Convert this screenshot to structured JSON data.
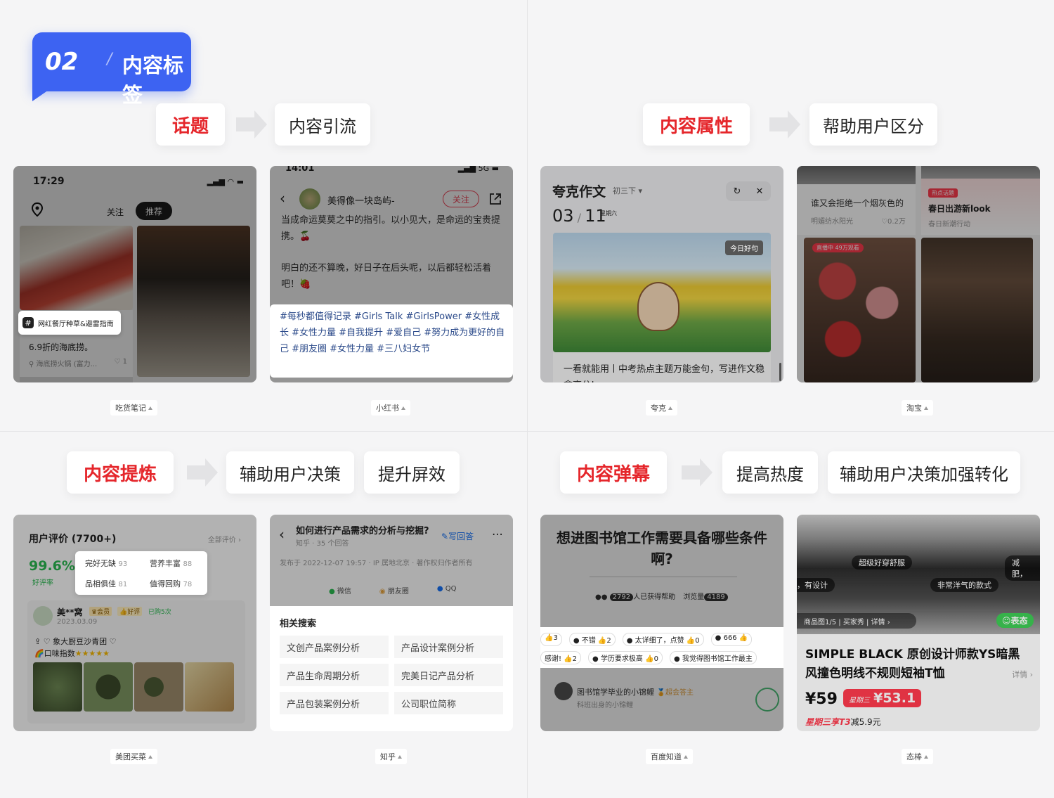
{
  "header": {
    "number": "02",
    "slash": "/",
    "title": "内容标签"
  },
  "sections": {
    "topic": {
      "main": "话题",
      "results": [
        "内容引流"
      ]
    },
    "attribute": {
      "main": "内容属性",
      "results": [
        "帮助用户区分"
      ]
    },
    "refine": {
      "main": "内容提炼",
      "results": [
        "辅助用户决策",
        "提升屏效"
      ]
    },
    "barrage": {
      "main": "内容弹幕",
      "results": [
        "提高热度",
        "辅助用户决策加强转化"
      ]
    }
  },
  "apps": [
    "吃货笔记",
    "小红书",
    "夸克",
    "淘宝",
    "美团买菜",
    "知乎",
    "百度知道",
    "态棒"
  ],
  "s1": {
    "time": "17:29",
    "tab_follow": "关注",
    "tab_recommend": "推荐",
    "topic_tag": "网红餐厅种草&避雷指南",
    "caption": "6.9折的海底捞。",
    "location": "海底捞火锅 (富力...",
    "likes": "1"
  },
  "s2": {
    "status_time": "14:01",
    "status_net": "5G",
    "author": "美得像一块岛屿-",
    "follow": "关注",
    "para1": "当成命运莫莫之中的指引。以小见大，是命运的宝贵提携。🍒",
    "para2": "明白的还不算晚，好日子在后头呢，以后都轻松活着吧！🍓",
    "hashtags": "#每秒都值得记录 #Girls Talk  #GirlsPower  #女性成长  #女性力量  #自我提升  #爱自己  #努力成为更好的自己 #朋友圈  #女性力量  #三八妇女节"
  },
  "s3": {
    "brand": "夸克作文",
    "lunar": "初三下",
    "date": "03",
    "date2": "11",
    "weekday": "星期六",
    "badge": "今日好句",
    "headline": "一看就能用丨中考热点主题万能金句，写进作文稳拿高分!"
  },
  "s4": {
    "tile1": "谁又会拒绝一个烟灰色的",
    "tile1_meta": "明媚纺水阳光",
    "tile1_likes": "0.2万",
    "tile2_badge": "热点话题",
    "tile2": "春日出游新look",
    "tile2_meta": "春日新潮行动",
    "live": "直播中",
    "live_count": "49万观看"
  },
  "s5": {
    "title": "用户评价 (7700+)",
    "all": "全部评价",
    "score": "99.6%",
    "score_label": "好评率",
    "chips": [
      {
        "t": "完好无缺",
        "n": "93"
      },
      {
        "t": "营养丰富",
        "n": "88"
      },
      {
        "t": "品相俱佳",
        "n": "81"
      },
      {
        "t": "值得回购",
        "n": "78"
      }
    ],
    "user": "美**窝",
    "vip": "会员",
    "good": "好评",
    "bought": "已购5次",
    "date": "2023.03.09",
    "product": "♡ 象大厨豆沙青团 ♡",
    "taste": "口味指数"
  },
  "s6": {
    "question": "如何进行产品需求的分析与挖掘?",
    "write": "写回答",
    "sub": "知乎 · 35 个回答",
    "meta": "发布于 2022-12-07 19:57 · IP 属地北京 · 著作权归作者所有",
    "shares": [
      "微信",
      "朋友圈",
      "QQ"
    ],
    "related_title": "相关搜索",
    "related": [
      "文创产品案例分析",
      "产品设计案例分析",
      "产品生命周期分析",
      "完美日记产品分析",
      "产品包装案例分析",
      "公司职位简称"
    ]
  },
  "s7": {
    "question": "想进图书馆工作需要具备哪些条件啊?",
    "helped_n": "2792",
    "helped": "人已获得帮助",
    "views": "浏览量",
    "views_n": "4189",
    "row1": [
      {
        "t": "3",
        "i": "👍"
      },
      {
        "t": "不错",
        "n": "2"
      },
      {
        "t": "太详细了，点赞",
        "n": "0"
      },
      {
        "t": "666",
        "n": ""
      }
    ],
    "row2": [
      {
        "t": "感谢!",
        "n": "2"
      },
      {
        "t": "学历要求极高",
        "n": "0"
      },
      {
        "t": "我觉得图书馆工作最主",
        "n": ""
      }
    ],
    "answerer": "图书馆学毕业的小锦鲤",
    "answerer_badge": "超会答主",
    "answerer_sub": "科班出身的小锦鲤"
  },
  "s8": {
    "b1": "超级好穿舒服",
    "b2": "减肥，",
    "b3": "，有设计",
    "b4": "非常洋气的款式",
    "gallery": "商品图1/5",
    "gallery2": "买家秀",
    "gallery3": "详情",
    "emote": "表态",
    "title": "SIMPLE BLACK 原创设计师款YS暗黑风撞色明线不规则短袖T恤",
    "detail": "详情",
    "price": "¥59",
    "promo_label": "星期三",
    "promo_price": "¥53.1",
    "coupon": "星期三享",
    "coupon_b": "T3",
    "coupon_c": "减5.9元"
  },
  "colors": {
    "accent": "#3d63f2",
    "red": "#e5262b"
  }
}
